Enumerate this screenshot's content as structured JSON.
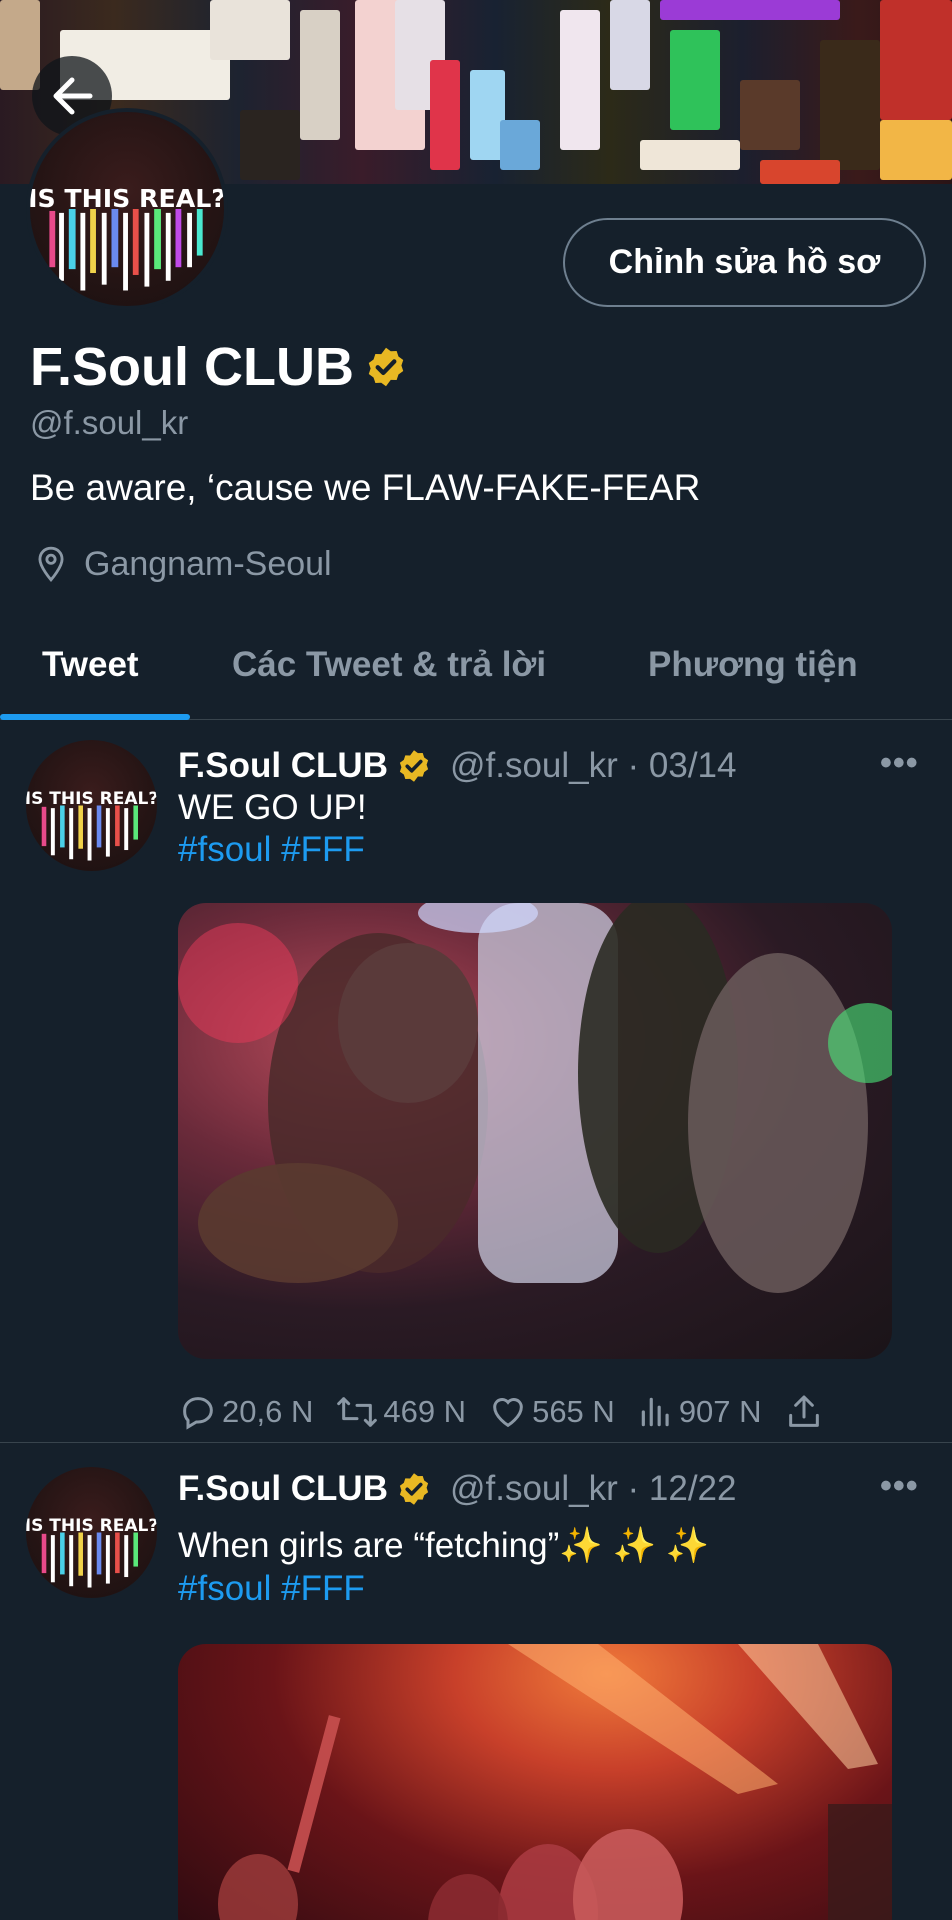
{
  "header": {
    "back_icon": "arrow-left-icon"
  },
  "profile": {
    "avatar_text": "IS THIS REAL?",
    "edit_button": "Chỉnh sửa hồ sơ",
    "name": "F.Soul CLUB",
    "verified_icon": "verified-badge-icon",
    "handle": "@f.soul_kr",
    "bio": "Be aware, ‘cause we FLAW-FAKE-FEAR",
    "location_icon": "location-pin-icon",
    "location": "Gangnam-Seoul"
  },
  "tabs": [
    {
      "label": "Tweet",
      "active": true
    },
    {
      "label": "Các Tweet & trả lời",
      "active": false
    },
    {
      "label": "Phương tiện",
      "active": false
    }
  ],
  "colors": {
    "background": "#15202b",
    "accent": "#1d9bf0",
    "muted": "#8b98a5",
    "verified": "#e8b823"
  },
  "tweets": [
    {
      "name": "F.Soul CLUB",
      "handle": "@f.soul_kr",
      "date": "03/14",
      "meta": "@f.soul_kr · 03/14",
      "text": "WE GO UP!",
      "hashtags": "#fsoul #FFF",
      "more": "•••",
      "actions": {
        "replies": "20,6 N",
        "retweets": "469 N",
        "likes": "565 N",
        "views": "907 N"
      }
    },
    {
      "name": "F.Soul CLUB",
      "handle": "@f.soul_kr",
      "date": "12/22",
      "meta": "@f.soul_kr · 12/22",
      "text": "When girls are “fetching”",
      "sparkles": "✨ ✨ ✨",
      "hashtags": "#fsoul #FFF",
      "more": "•••"
    }
  ]
}
